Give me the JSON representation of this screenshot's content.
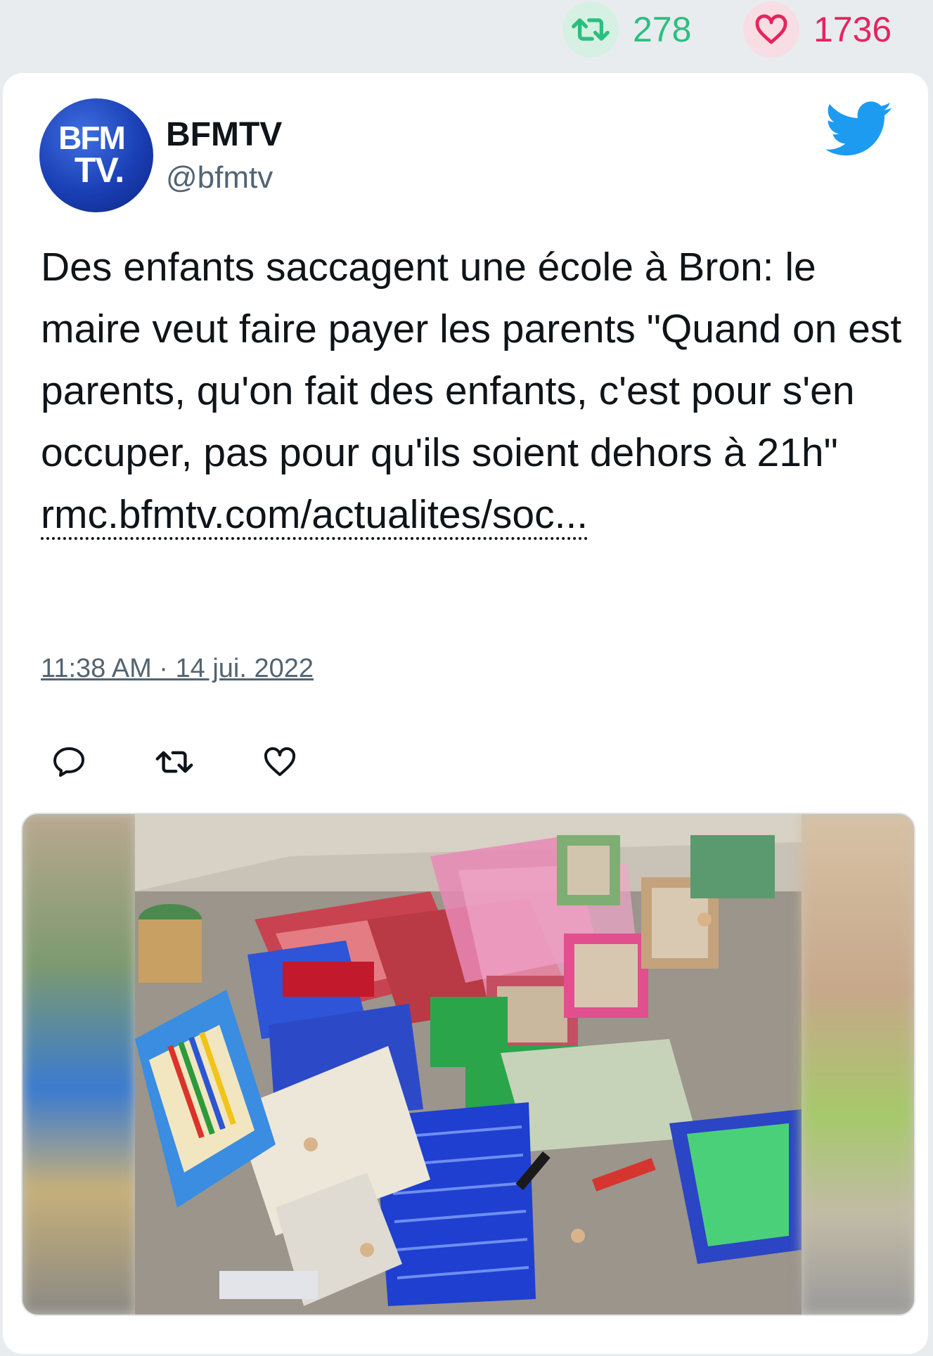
{
  "stats": {
    "retweet_count": "278",
    "like_count": "1736",
    "retweet_icon": "retweet-icon",
    "like_icon": "heart-icon",
    "retweet_color": "#2bbf7f",
    "like_color": "#e5245e"
  },
  "tweet": {
    "avatar_text_line1": "BFM",
    "avatar_text_line2": "TV.",
    "author_name": "BFMTV",
    "author_handle": "@bfmtv",
    "text": "Des enfants saccagent une école à Bron: le maire veut faire payer les parents \"Quand on est parents, qu'on fait des enfants, c'est pour s'en occuper, pas pour qu'ils soient dehors à 21h\"",
    "link": "rmc.bfmtv.com/actualites/soc...",
    "timestamp": "11:38 AM · 14 jui. 2022",
    "brand_icon": "twitter-bird-icon",
    "brand_color": "#1d9bf0"
  },
  "actions": {
    "reply_icon": "reply-icon",
    "retweet_icon": "retweet-icon",
    "like_icon": "heart-icon"
  },
  "media": {
    "description_icon": "photo-image"
  }
}
